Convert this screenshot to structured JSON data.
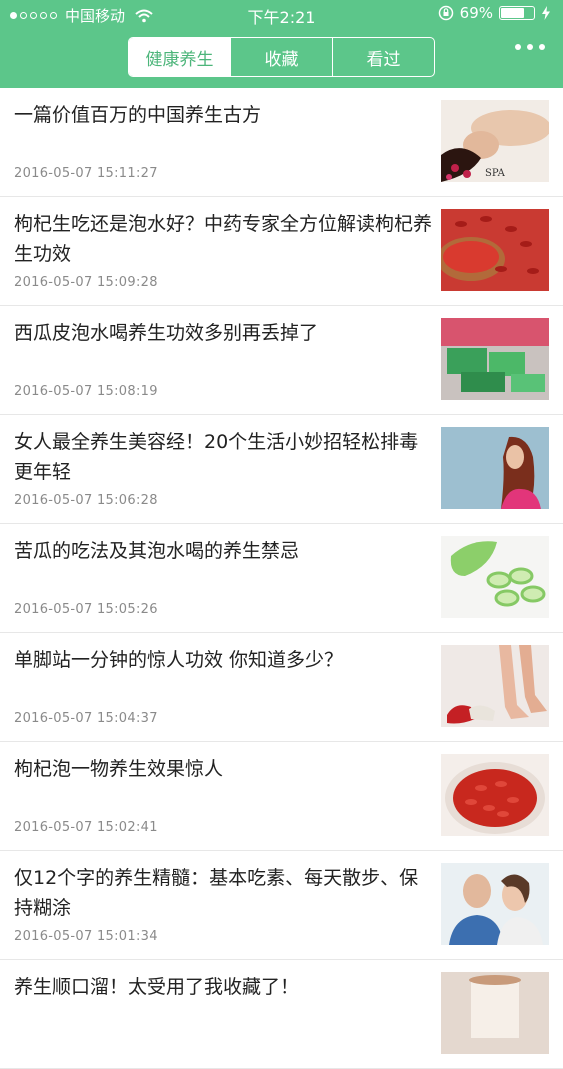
{
  "status_bar": {
    "carrier": "中国移动",
    "time": "下午2:21",
    "battery": "69%"
  },
  "tabs": [
    "健康养生",
    "收藏",
    "看过"
  ],
  "articles": [
    {
      "title": "一篇价值百万的中国养生古方",
      "date": "2016-05-07 15:11:27",
      "thumb": "massage-photo"
    },
    {
      "title": "枸杞生吃还是泡水好？中药专家全方位解读枸杞养生功效",
      "date": "2016-05-07 15:09:28",
      "thumb": "goji-berries-photo"
    },
    {
      "title": "西瓜皮泡水喝养生功效多别再丢掉了",
      "date": "2016-05-07 15:08:19",
      "thumb": "watermelon-photo"
    },
    {
      "title": "女人最全养生美容经！20个生活小妙招轻松排毒更年轻",
      "date": "2016-05-07 15:06:28",
      "thumb": "woman-photo"
    },
    {
      "title": "苦瓜的吃法及其泡水喝的养生禁忌",
      "date": "2016-05-07 15:05:26",
      "thumb": "bitter-melon-photo"
    },
    {
      "title": "单脚站一分钟的惊人功效 你知道多少？",
      "date": "2016-05-07 15:04:37",
      "thumb": "legs-photo"
    },
    {
      "title": "枸杞泡一物养生效果惊人",
      "date": "2016-05-07 15:02:41",
      "thumb": "goji-bowl-photo"
    },
    {
      "title": "仅12个字的养生精髓：基本吃素、每天散步、保持糊涂",
      "date": "2016-05-07 15:01:34",
      "thumb": "elderly-couple-photo"
    },
    {
      "title": "养生顺口溜！太受用了我收藏了！",
      "date": "",
      "thumb": "drink-photo"
    }
  ]
}
